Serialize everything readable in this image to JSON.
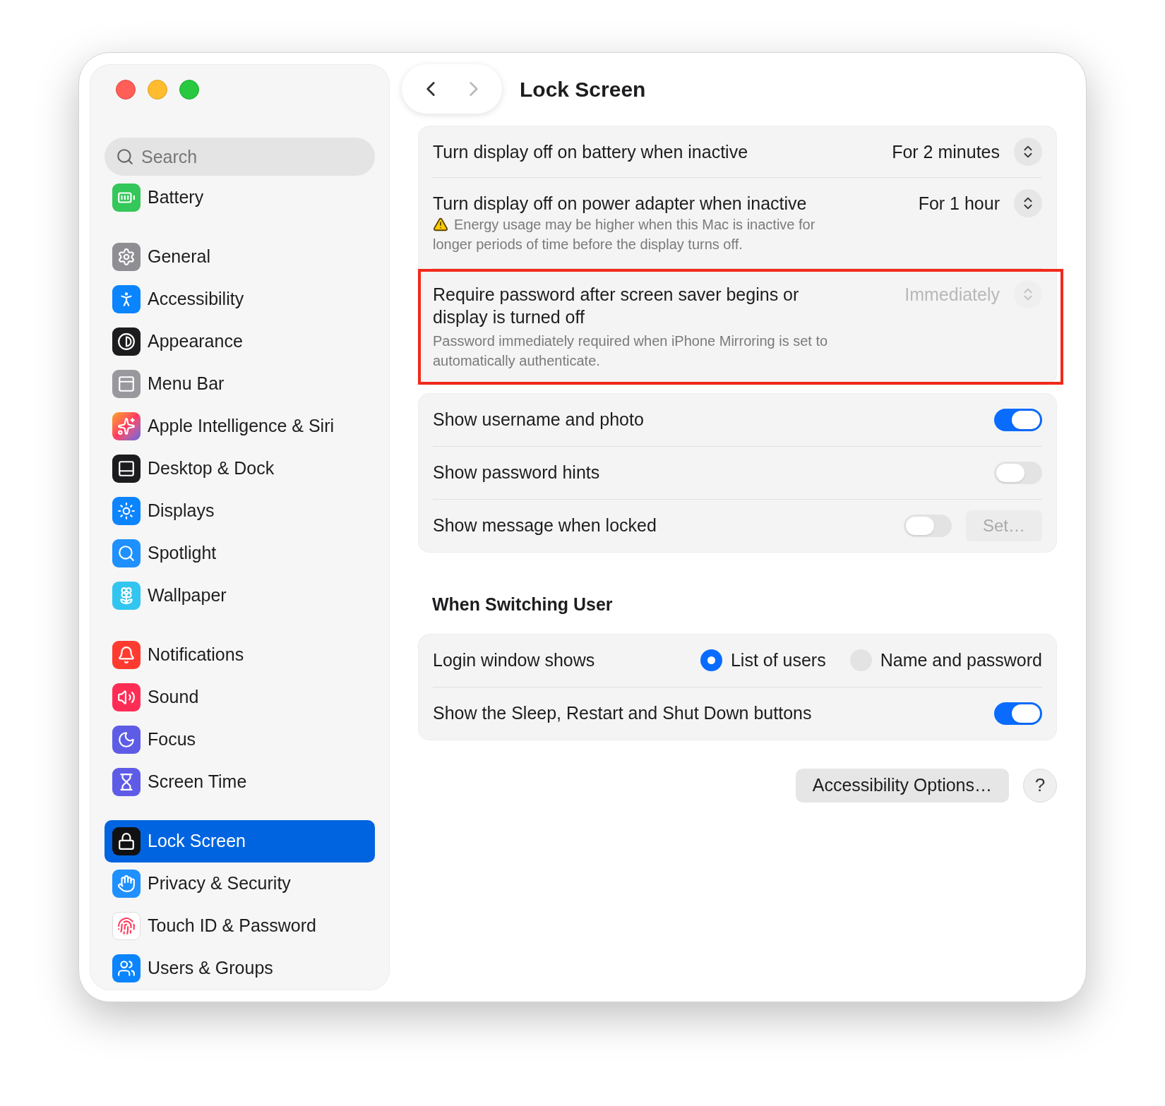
{
  "window": {
    "title": "Lock Screen"
  },
  "navigation": {
    "back": {
      "disabled": false
    },
    "forward": {
      "disabled": true
    }
  },
  "sidebar": {
    "search": {
      "placeholder": "Search"
    },
    "groups": [
      {
        "items": [
          {
            "label": "Battery",
            "selected": false
          }
        ]
      },
      {
        "items": [
          {
            "label": "General",
            "selected": false
          },
          {
            "label": "Accessibility",
            "selected": false
          },
          {
            "label": "Appearance",
            "selected": false
          },
          {
            "label": "Menu Bar",
            "selected": false
          },
          {
            "label": "Apple Intelligence & Siri",
            "selected": false
          },
          {
            "label": "Desktop & Dock",
            "selected": false
          },
          {
            "label": "Displays",
            "selected": false
          },
          {
            "label": "Spotlight",
            "selected": false
          },
          {
            "label": "Wallpaper",
            "selected": false
          }
        ]
      },
      {
        "items": [
          {
            "label": "Notifications",
            "selected": false
          },
          {
            "label": "Sound",
            "selected": false
          },
          {
            "label": "Focus",
            "selected": false
          },
          {
            "label": "Screen Time",
            "selected": false
          }
        ]
      },
      {
        "items": [
          {
            "label": "Lock Screen",
            "selected": true
          },
          {
            "label": "Privacy & Security",
            "selected": false
          },
          {
            "label": "Touch ID & Password",
            "selected": false
          },
          {
            "label": "Users & Groups",
            "selected": false
          }
        ]
      }
    ]
  },
  "groups": [
    {
      "rows": [
        {
          "kind": "popup",
          "label": "Turn display off on battery when inactive",
          "value": "For 2 minutes",
          "disabled": false,
          "highlighted": false
        },
        {
          "kind": "popup",
          "label": "Turn display off on power adapter when inactive",
          "warning": "Energy usage may be higher when this Mac is inactive for longer periods of time before the display turns off.",
          "value": "For 1 hour",
          "disabled": false,
          "highlighted": false
        },
        {
          "kind": "popup",
          "label": "Require password after screen saver begins or display is turned off",
          "note": "Password immediately required when iPhone Mirroring is set to automatically authenticate.",
          "value": "Immediately",
          "disabled": true,
          "highlighted": true
        }
      ]
    },
    {
      "rows": [
        {
          "kind": "toggle",
          "label": "Show username and photo",
          "on": true
        },
        {
          "kind": "toggle",
          "label": "Show password hints",
          "on": false
        },
        {
          "kind": "toggle",
          "label": "Show message when locked",
          "on": false,
          "button": {
            "label": "Set…",
            "disabled": true
          }
        }
      ]
    },
    {
      "heading": "When Switching User",
      "rows": [
        {
          "kind": "radio",
          "label": "Login window shows",
          "options": [
            {
              "label": "List of users",
              "selected": true
            },
            {
              "label": "Name and password",
              "selected": false
            }
          ]
        },
        {
          "kind": "toggle",
          "label": "Show the Sleep, Restart and Shut Down buttons",
          "on": true
        }
      ]
    }
  ],
  "footer": {
    "buttons": [
      {
        "label": "Accessibility Options…"
      }
    ],
    "help": "?"
  }
}
